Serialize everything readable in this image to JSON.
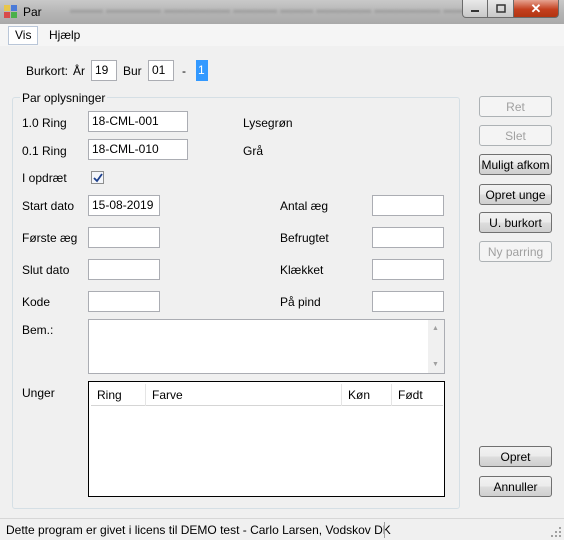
{
  "window": {
    "title": "Par",
    "close_glyph": "✕"
  },
  "menu": [
    {
      "label": "Vis"
    },
    {
      "label": "Hjælp"
    }
  ],
  "burkort": {
    "label": "Burkort:",
    "year_label": "År",
    "year_value": "19",
    "cage_label": "Bur",
    "cage_value": "01",
    "dash": "-",
    "slot_value": "1"
  },
  "pair_info": {
    "legend": "Par oplysninger",
    "ring1_label": "1.0 Ring",
    "ring1_value": "18-CML-001",
    "ring1_color": "Lysegrøn",
    "ring2_label": "0.1 Ring",
    "ring2_value": "18-CML-010",
    "ring2_color": "Grå",
    "breeding_label": "I opdræt",
    "breeding_checked": true,
    "start_label": "Start dato",
    "start_value": "15-08-2019",
    "first_egg_label": "Første æg",
    "first_egg_value": "",
    "end_label": "Slut dato",
    "end_value": "",
    "code_label": "Kode",
    "code_value": "",
    "eggs_label": "Antal æg",
    "eggs_value": "",
    "fertilized_label": "Befrugtet",
    "fertilized_value": "",
    "hatched_label": "Klækket",
    "hatched_value": "",
    "fledged_label": "På pind",
    "fledged_value": "",
    "remarks_label": "Bem.:",
    "young_label": "Unger",
    "young_columns": [
      "Ring",
      "Farve",
      "Køn",
      "Født"
    ]
  },
  "buttons": {
    "ret": "Ret",
    "slet": "Slet",
    "muligt_afkom": "Muligt afkom",
    "opret_unge": "Opret unge",
    "u_burkort": "U. burkort",
    "ny_parring": "Ny parring",
    "opret": "Opret",
    "annuller": "Annuller"
  },
  "status": {
    "text": "Dette program er givet i licens til DEMO test - Carlo Larsen, Vodskov DK"
  }
}
